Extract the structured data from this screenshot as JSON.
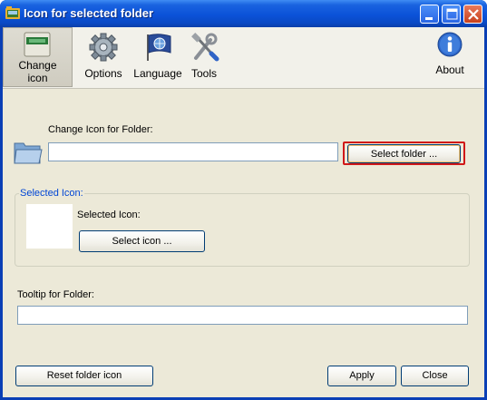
{
  "window": {
    "title": "Icon for selected folder"
  },
  "toolbar": {
    "change_icon": "Change\nicon",
    "options": "Options",
    "language": "Language",
    "tools": "Tools",
    "about": "About"
  },
  "folder_section": {
    "label": "Change Icon for Folder:",
    "folder_path_value": "",
    "select_folder_button": "Select folder ..."
  },
  "selected_icon_group": {
    "legend": "Selected Icon:",
    "label": "Selected Icon:",
    "select_icon_button": "Select icon ..."
  },
  "tooltip_section": {
    "label": "Tooltip for Folder:",
    "tooltip_value": ""
  },
  "footer": {
    "reset_button": "Reset folder icon",
    "apply_button": "Apply",
    "close_button": "Close"
  },
  "colors": {
    "titlebar": "#0b52d8",
    "window_bg": "#ece9d8",
    "highlight_border": "#d01818",
    "group_legend": "#0046d5"
  }
}
